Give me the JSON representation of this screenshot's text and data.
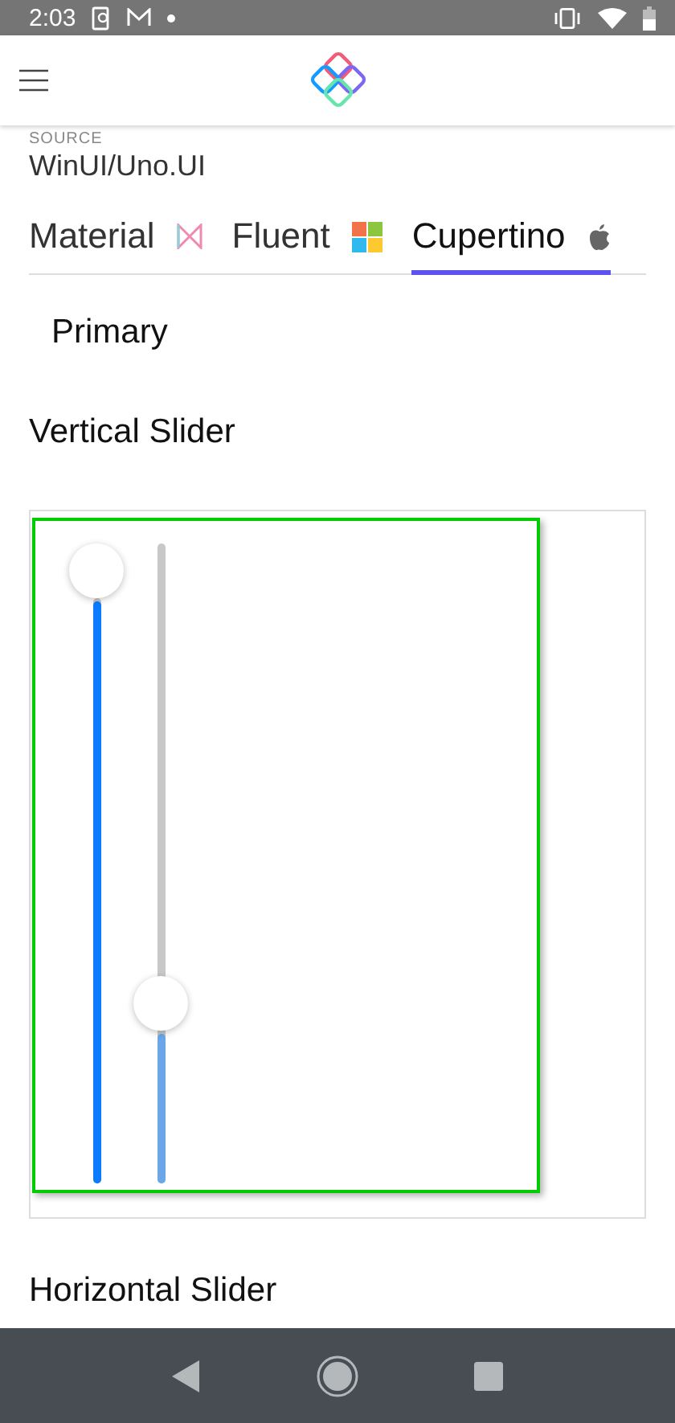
{
  "status_bar": {
    "time": "2:03"
  },
  "source": {
    "label": "SOURCE",
    "value": "WinUI/Uno.UI"
  },
  "tabs": [
    {
      "label": "Material",
      "selected": false
    },
    {
      "label": "Fluent",
      "selected": false
    },
    {
      "label": "Cupertino",
      "selected": true
    }
  ],
  "variant": "Primary",
  "section_title": "Vertical Slider",
  "sliders": [
    {
      "level": 1.0,
      "disabled": false
    },
    {
      "level": 0.26,
      "disabled": true
    }
  ],
  "next_section_title": "Horizontal Slider"
}
